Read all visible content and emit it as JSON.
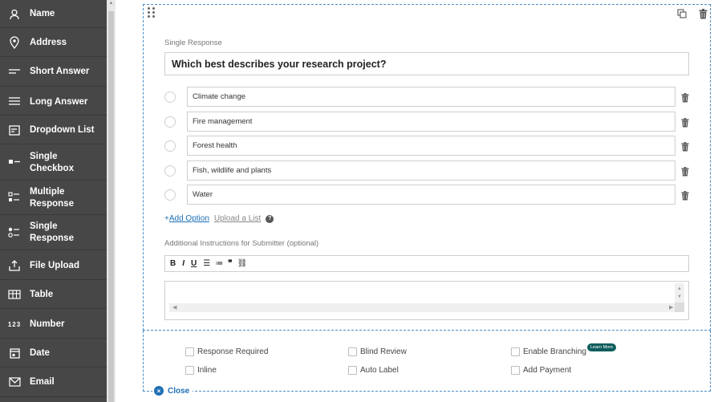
{
  "sidebar": {
    "items": [
      {
        "label": "Name",
        "icon": "person-icon"
      },
      {
        "label": "Address",
        "icon": "location-pin-icon"
      },
      {
        "label": "Short Answer",
        "icon": "short-answer-icon"
      },
      {
        "label": "Long Answer",
        "icon": "long-answer-icon"
      },
      {
        "label": "Dropdown List",
        "icon": "dropdown-list-icon"
      },
      {
        "label": "Single\nCheckbox",
        "icon": "single-checkbox-icon"
      },
      {
        "label": "Multiple\nResponse",
        "icon": "multiple-response-icon"
      },
      {
        "label": "Single\nResponse",
        "icon": "single-response-icon"
      },
      {
        "label": "File Upload",
        "icon": "upload-icon"
      },
      {
        "label": "Table",
        "icon": "table-icon"
      },
      {
        "label": "Number",
        "icon": "number-icon",
        "glyph": "123"
      },
      {
        "label": "Date",
        "icon": "calendar-icon"
      },
      {
        "label": "Email",
        "icon": "envelope-icon"
      }
    ]
  },
  "question": {
    "type_label": "Single Response",
    "text": "Which best describes your research project?",
    "options": [
      "Climate change",
      "Fire management",
      "Forest health",
      "Fish, wildlife and plants",
      "Water"
    ],
    "add_option_plus": "+",
    "add_option": "Add Option",
    "upload_list": "Upload a List",
    "help_glyph": "?",
    "instructions_label": "Additional Instructions for Submitter (optional)",
    "toolbar": [
      "B",
      "I",
      "U",
      "☰",
      "≔",
      "❞",
      "⛓"
    ]
  },
  "settings": {
    "checkboxes": [
      {
        "label": "Response Required",
        "checked": false
      },
      {
        "label": "Blind Review",
        "checked": false
      },
      {
        "label": "Enable Branching",
        "checked": false
      },
      {
        "label": "Inline",
        "checked": false
      },
      {
        "label": "Auto Label",
        "checked": false
      },
      {
        "label": "Add Payment",
        "checked": false
      }
    ],
    "learn_more": "Learn More"
  },
  "close": {
    "label": "Close",
    "glyph": "×"
  },
  "colors": {
    "sidebar_bg": "#474747",
    "accent_blue": "#1f6fb5",
    "dashed_border": "#4c8bc5",
    "learn_more_bg": "#0e5d5d"
  }
}
